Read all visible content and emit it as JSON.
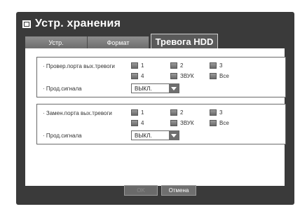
{
  "window": {
    "title": "Устр. хранения"
  },
  "tabs": [
    {
      "label": "Устр."
    },
    {
      "label": "Формат"
    },
    {
      "label": "Тревога HDD"
    }
  ],
  "groups": [
    {
      "alarm_label": "· Провер.порта вых.тревоги",
      "options": [
        "1",
        "2",
        "3",
        "4",
        "ЗВУК",
        "Все"
      ],
      "duration_label": "· Прод.сигнала",
      "duration_value": "ВЫКЛ."
    },
    {
      "alarm_label": "· Замен.порта вых.тревоги",
      "options": [
        "1",
        "2",
        "3",
        "4",
        "ЗВУК",
        "Все"
      ],
      "duration_label": "· Прод.сигнала",
      "duration_value": "ВЫКЛ."
    }
  ],
  "buttons": {
    "ok": "OK",
    "cancel": "Отмена"
  }
}
